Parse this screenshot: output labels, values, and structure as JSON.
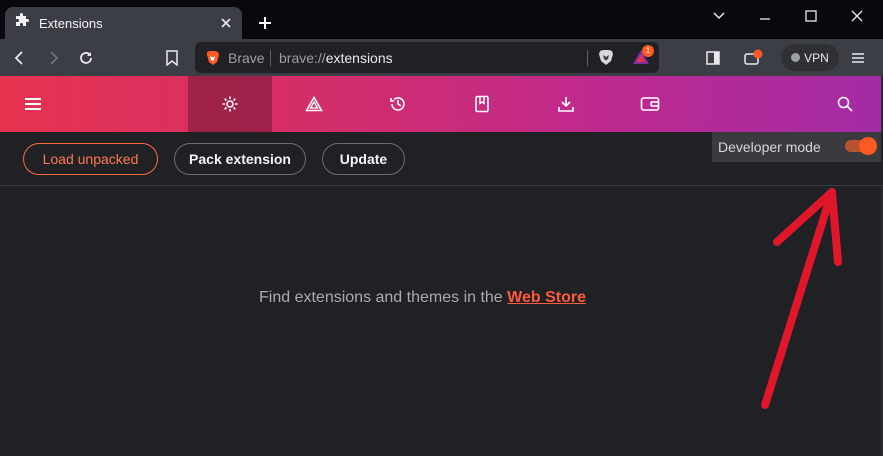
{
  "tab": {
    "title": "Extensions",
    "icon": "puzzle-icon"
  },
  "toolbar": {
    "brave_label": "Brave",
    "url_scheme": "brave://",
    "url_path": "extensions",
    "rewards_badge": "1",
    "vpn_label": "VPN"
  },
  "navbar": {
    "items": [
      "hamburger-icon",
      "gear-icon",
      "brave-rewards-icon",
      "history-icon",
      "bookmarks-icon",
      "downloads-icon",
      "wallet-icon",
      "search-icon"
    ],
    "active": "gear-icon"
  },
  "actions": {
    "load_unpacked": "Load unpacked",
    "pack_extension": "Pack extension",
    "update": "Update"
  },
  "developer_mode": {
    "label": "Developer mode",
    "enabled": true
  },
  "main": {
    "message": "Find extensions and themes in the ",
    "link": "Web Store"
  },
  "colors": {
    "accent": "#ff5a24",
    "gradient_start": "#e6334f",
    "gradient_end": "#a32ba6",
    "arrow": "#e0162b"
  }
}
